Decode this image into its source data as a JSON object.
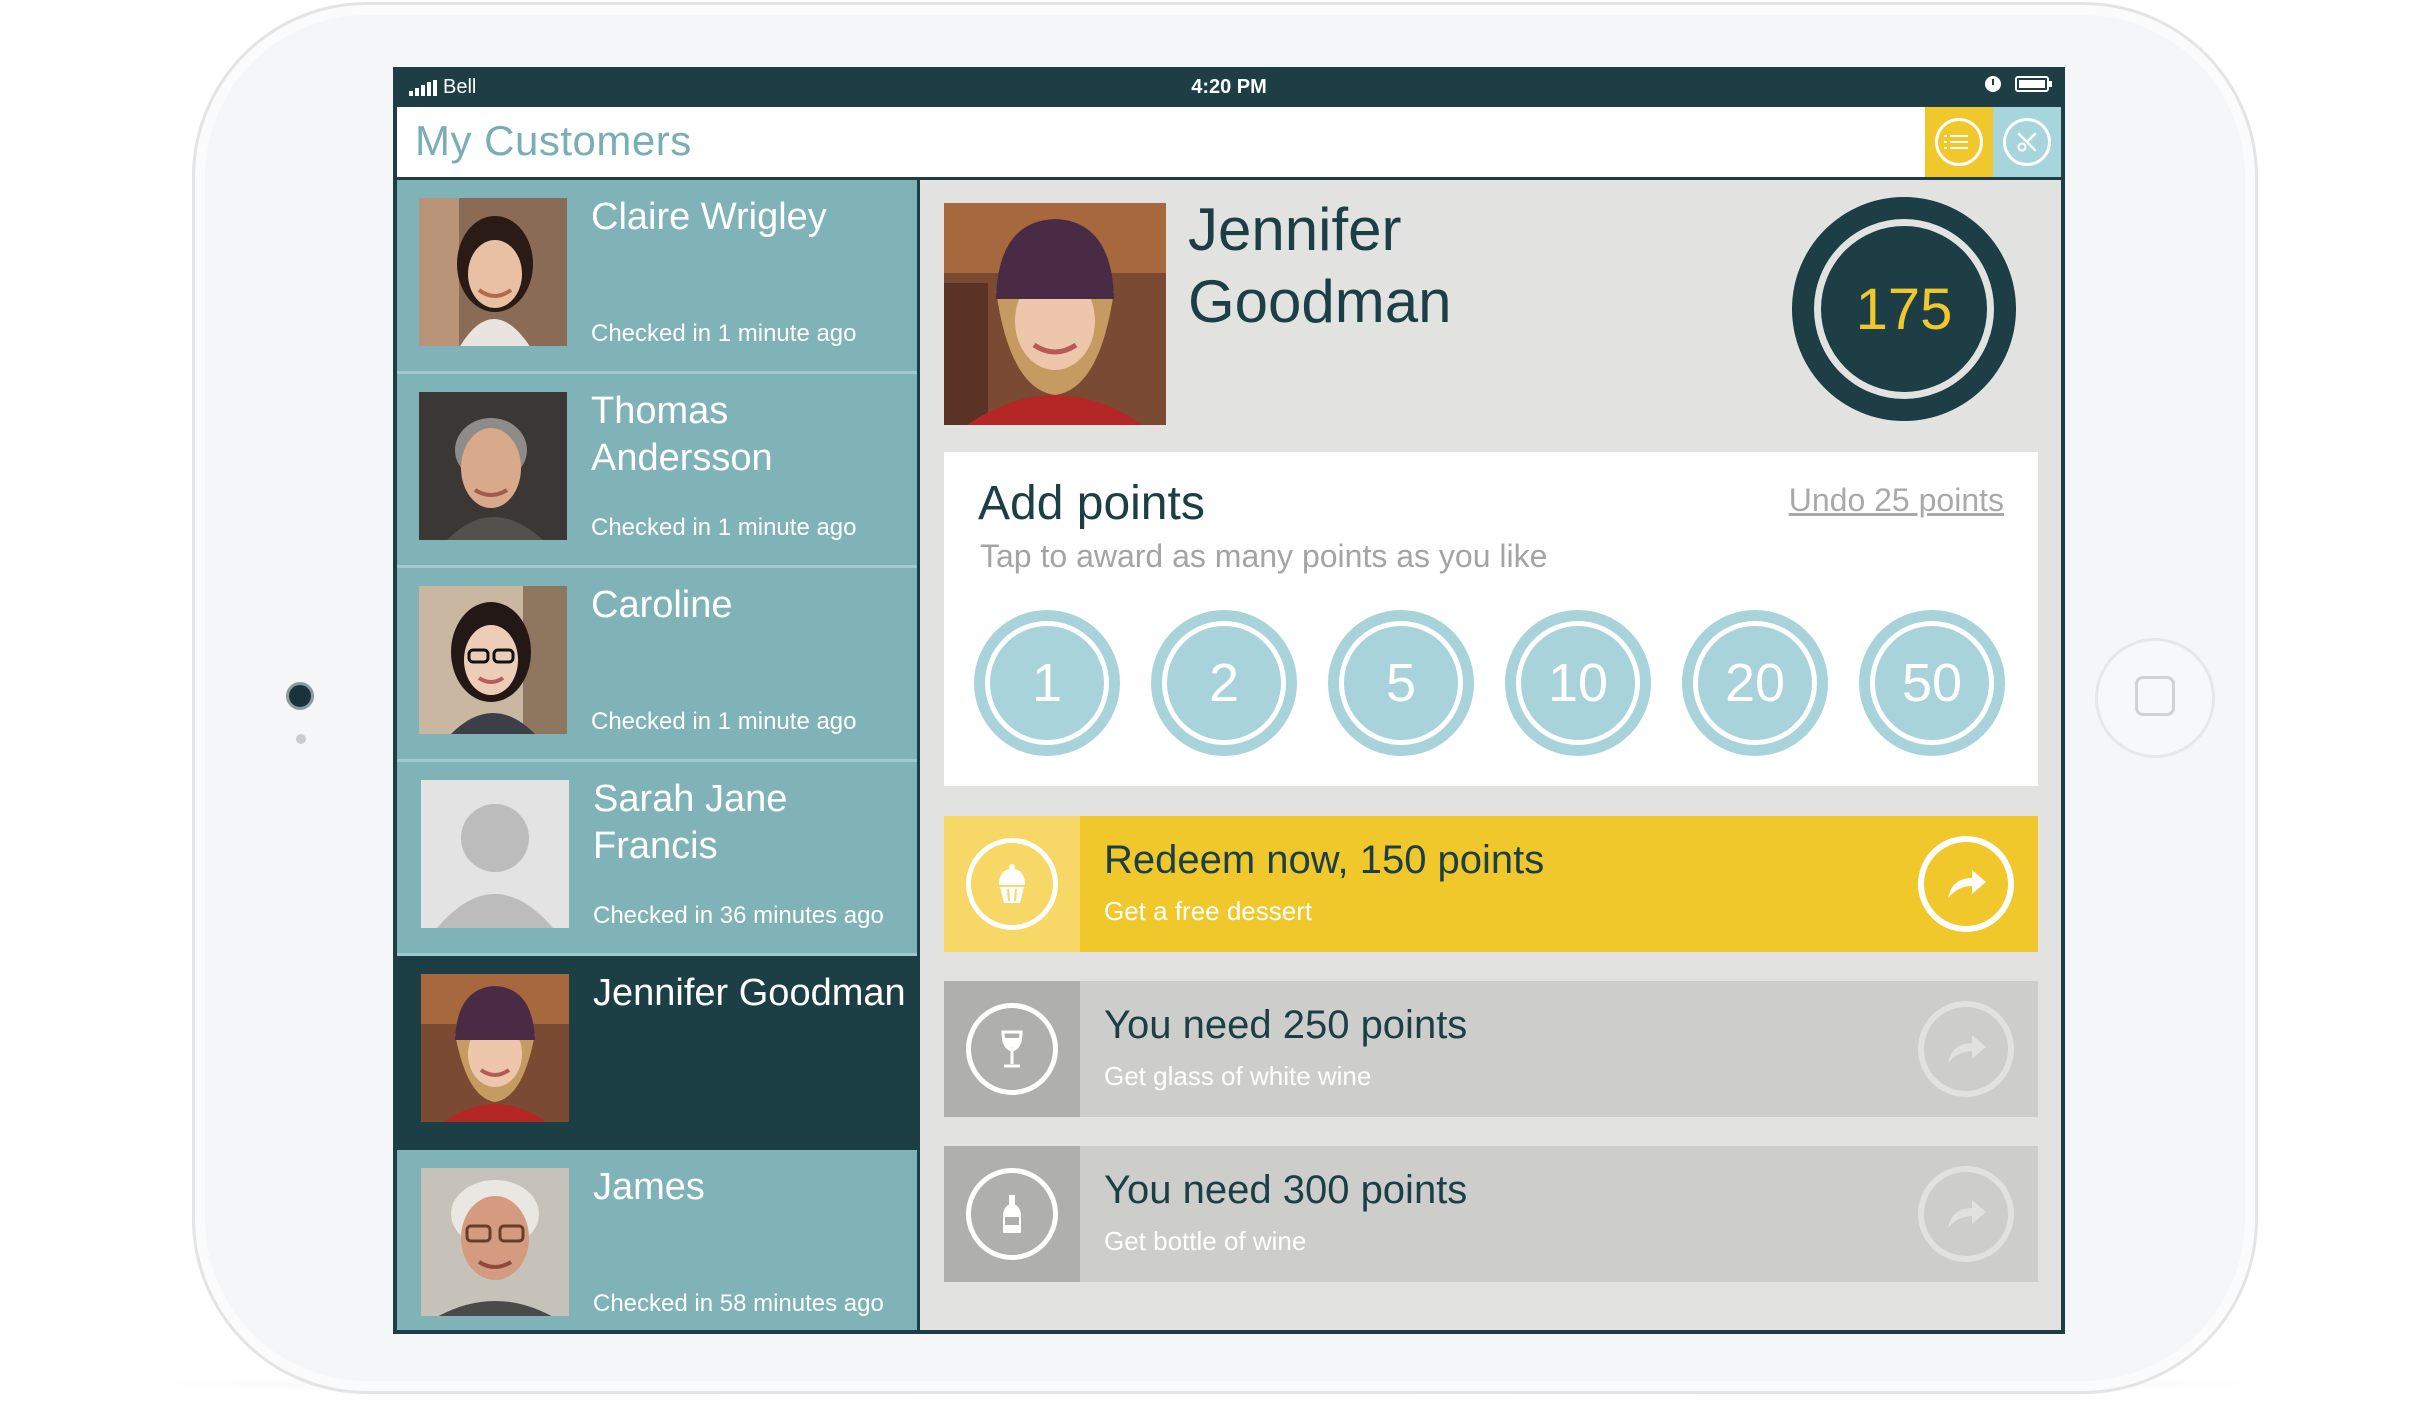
{
  "status_bar": {
    "carrier": "Bell",
    "time": "4:20 PM"
  },
  "header": {
    "title": "My Customers"
  },
  "customers": [
    {
      "name": "Claire Wrigley",
      "checked_in": "Checked in 1 minute ago"
    },
    {
      "name": "Thomas Andersson",
      "checked_in": "Checked in 1 minute ago"
    },
    {
      "name": "Caroline",
      "checked_in": "Checked in 1 minute ago"
    },
    {
      "name": "Sarah Jane Francis",
      "checked_in": "Checked in 36 minutes ago"
    },
    {
      "name": "Jennifer Goodman",
      "checked_in": ""
    },
    {
      "name": "James",
      "checked_in": "Checked in 58 minutes ago"
    }
  ],
  "profile": {
    "first_name": "Jennifer",
    "last_name": "Goodman",
    "points": "175"
  },
  "add_points": {
    "title": "Add points",
    "subtitle": "Tap to award as many points as you like",
    "undo_label": "Undo 25 points",
    "options": [
      "1",
      "2",
      "5",
      "10",
      "20",
      "50"
    ]
  },
  "rewards": [
    {
      "title": "Redeem now, 150 points",
      "description": "Get a free dessert",
      "icon": "cupcake-icon",
      "available": true
    },
    {
      "title": "You need 250 points",
      "description": "Get glass of white wine",
      "icon": "wine-glass-icon",
      "available": false
    },
    {
      "title": "You need 300 points",
      "description": "Get bottle of wine",
      "icon": "wine-bottle-icon",
      "available": false
    }
  ],
  "colors": {
    "accent_yellow": "#f1c82c",
    "dark_teal": "#1d3e45",
    "sidebar_teal": "#7fb3b8",
    "light_blue": "#a9d3da",
    "title_teal": "#79aeb5"
  }
}
